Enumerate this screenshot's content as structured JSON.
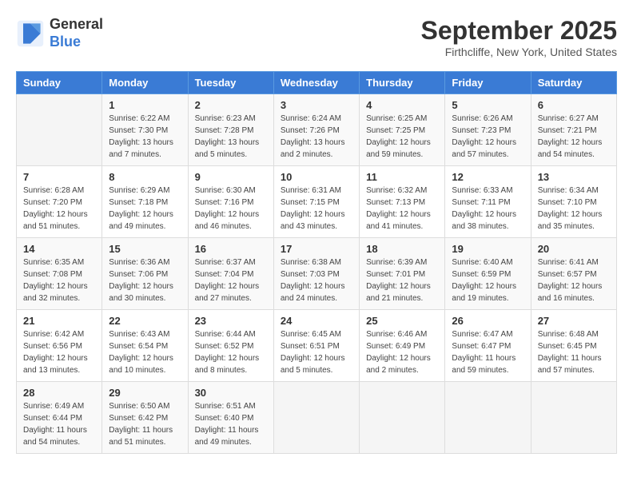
{
  "header": {
    "logo_line1": "General",
    "logo_line2": "Blue",
    "month": "September 2025",
    "location": "Firthcliffe, New York, United States"
  },
  "weekdays": [
    "Sunday",
    "Monday",
    "Tuesday",
    "Wednesday",
    "Thursday",
    "Friday",
    "Saturday"
  ],
  "weeks": [
    [
      {
        "day": "",
        "info": ""
      },
      {
        "day": "1",
        "info": "Sunrise: 6:22 AM\nSunset: 7:30 PM\nDaylight: 13 hours\nand 7 minutes."
      },
      {
        "day": "2",
        "info": "Sunrise: 6:23 AM\nSunset: 7:28 PM\nDaylight: 13 hours\nand 5 minutes."
      },
      {
        "day": "3",
        "info": "Sunrise: 6:24 AM\nSunset: 7:26 PM\nDaylight: 13 hours\nand 2 minutes."
      },
      {
        "day": "4",
        "info": "Sunrise: 6:25 AM\nSunset: 7:25 PM\nDaylight: 12 hours\nand 59 minutes."
      },
      {
        "day": "5",
        "info": "Sunrise: 6:26 AM\nSunset: 7:23 PM\nDaylight: 12 hours\nand 57 minutes."
      },
      {
        "day": "6",
        "info": "Sunrise: 6:27 AM\nSunset: 7:21 PM\nDaylight: 12 hours\nand 54 minutes."
      }
    ],
    [
      {
        "day": "7",
        "info": "Sunrise: 6:28 AM\nSunset: 7:20 PM\nDaylight: 12 hours\nand 51 minutes."
      },
      {
        "day": "8",
        "info": "Sunrise: 6:29 AM\nSunset: 7:18 PM\nDaylight: 12 hours\nand 49 minutes."
      },
      {
        "day": "9",
        "info": "Sunrise: 6:30 AM\nSunset: 7:16 PM\nDaylight: 12 hours\nand 46 minutes."
      },
      {
        "day": "10",
        "info": "Sunrise: 6:31 AM\nSunset: 7:15 PM\nDaylight: 12 hours\nand 43 minutes."
      },
      {
        "day": "11",
        "info": "Sunrise: 6:32 AM\nSunset: 7:13 PM\nDaylight: 12 hours\nand 41 minutes."
      },
      {
        "day": "12",
        "info": "Sunrise: 6:33 AM\nSunset: 7:11 PM\nDaylight: 12 hours\nand 38 minutes."
      },
      {
        "day": "13",
        "info": "Sunrise: 6:34 AM\nSunset: 7:10 PM\nDaylight: 12 hours\nand 35 minutes."
      }
    ],
    [
      {
        "day": "14",
        "info": "Sunrise: 6:35 AM\nSunset: 7:08 PM\nDaylight: 12 hours\nand 32 minutes."
      },
      {
        "day": "15",
        "info": "Sunrise: 6:36 AM\nSunset: 7:06 PM\nDaylight: 12 hours\nand 30 minutes."
      },
      {
        "day": "16",
        "info": "Sunrise: 6:37 AM\nSunset: 7:04 PM\nDaylight: 12 hours\nand 27 minutes."
      },
      {
        "day": "17",
        "info": "Sunrise: 6:38 AM\nSunset: 7:03 PM\nDaylight: 12 hours\nand 24 minutes."
      },
      {
        "day": "18",
        "info": "Sunrise: 6:39 AM\nSunset: 7:01 PM\nDaylight: 12 hours\nand 21 minutes."
      },
      {
        "day": "19",
        "info": "Sunrise: 6:40 AM\nSunset: 6:59 PM\nDaylight: 12 hours\nand 19 minutes."
      },
      {
        "day": "20",
        "info": "Sunrise: 6:41 AM\nSunset: 6:57 PM\nDaylight: 12 hours\nand 16 minutes."
      }
    ],
    [
      {
        "day": "21",
        "info": "Sunrise: 6:42 AM\nSunset: 6:56 PM\nDaylight: 12 hours\nand 13 minutes."
      },
      {
        "day": "22",
        "info": "Sunrise: 6:43 AM\nSunset: 6:54 PM\nDaylight: 12 hours\nand 10 minutes."
      },
      {
        "day": "23",
        "info": "Sunrise: 6:44 AM\nSunset: 6:52 PM\nDaylight: 12 hours\nand 8 minutes."
      },
      {
        "day": "24",
        "info": "Sunrise: 6:45 AM\nSunset: 6:51 PM\nDaylight: 12 hours\nand 5 minutes."
      },
      {
        "day": "25",
        "info": "Sunrise: 6:46 AM\nSunset: 6:49 PM\nDaylight: 12 hours\nand 2 minutes."
      },
      {
        "day": "26",
        "info": "Sunrise: 6:47 AM\nSunset: 6:47 PM\nDaylight: 11 hours\nand 59 minutes."
      },
      {
        "day": "27",
        "info": "Sunrise: 6:48 AM\nSunset: 6:45 PM\nDaylight: 11 hours\nand 57 minutes."
      }
    ],
    [
      {
        "day": "28",
        "info": "Sunrise: 6:49 AM\nSunset: 6:44 PM\nDaylight: 11 hours\nand 54 minutes."
      },
      {
        "day": "29",
        "info": "Sunrise: 6:50 AM\nSunset: 6:42 PM\nDaylight: 11 hours\nand 51 minutes."
      },
      {
        "day": "30",
        "info": "Sunrise: 6:51 AM\nSunset: 6:40 PM\nDaylight: 11 hours\nand 49 minutes."
      },
      {
        "day": "",
        "info": ""
      },
      {
        "day": "",
        "info": ""
      },
      {
        "day": "",
        "info": ""
      },
      {
        "day": "",
        "info": ""
      }
    ]
  ]
}
